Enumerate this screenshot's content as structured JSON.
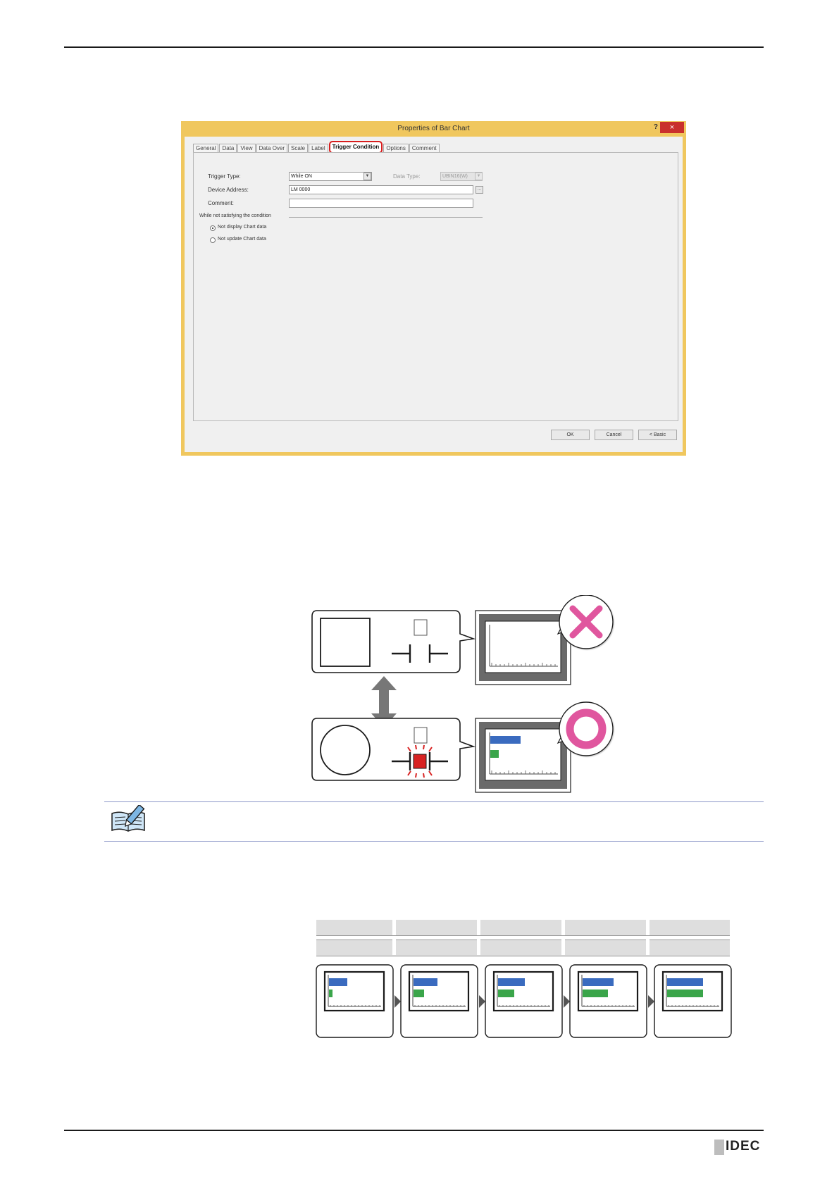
{
  "dialog": {
    "title": "Properties of Bar Chart",
    "help_label": "?",
    "close_label": "×",
    "tabs": [
      "General",
      "Data",
      "View",
      "Data Over",
      "Scale",
      "Label",
      "Trigger Condition",
      "Options",
      "Comment"
    ],
    "active_tab": "Trigger Condition",
    "trigger_type_label": "Trigger Type:",
    "trigger_type_value": "While ON",
    "data_type_label": "Data Type:",
    "data_type_value": "UBIN16(W)",
    "device_address_label": "Device Address:",
    "device_address_value": "LM 0000",
    "browse_label": "...",
    "comment_label": "Comment:",
    "comment_value": "",
    "group_label": "While not satisfying the condition",
    "radio_options": [
      "Not display Chart data",
      "Not update Chart data"
    ],
    "radio_selected": 0,
    "buttons": {
      "ok": "OK",
      "cancel": "Cancel",
      "basic": "< Basic"
    }
  },
  "branding": {
    "logo_text": "IDEC"
  },
  "colors": {
    "dialog_frame": "#f0c75e",
    "highlight": "#d81d1d",
    "bar_blue": "#3a6bbf",
    "bar_green": "#3aa54a",
    "mark": "#e0569e"
  },
  "sequence": {
    "frames": [
      {
        "blue": 0.35,
        "green": 0.06
      },
      {
        "blue": 0.45,
        "green": 0.2
      },
      {
        "blue": 0.5,
        "green": 0.3
      },
      {
        "blue": 0.58,
        "green": 0.48
      },
      {
        "blue": 0.68,
        "green": 0.68
      }
    ]
  },
  "state_diagram": {
    "off_state": {
      "chart_shown": false
    },
    "on_state": {
      "chart_shown": true,
      "blue": 0.45,
      "green": 0.13
    }
  }
}
